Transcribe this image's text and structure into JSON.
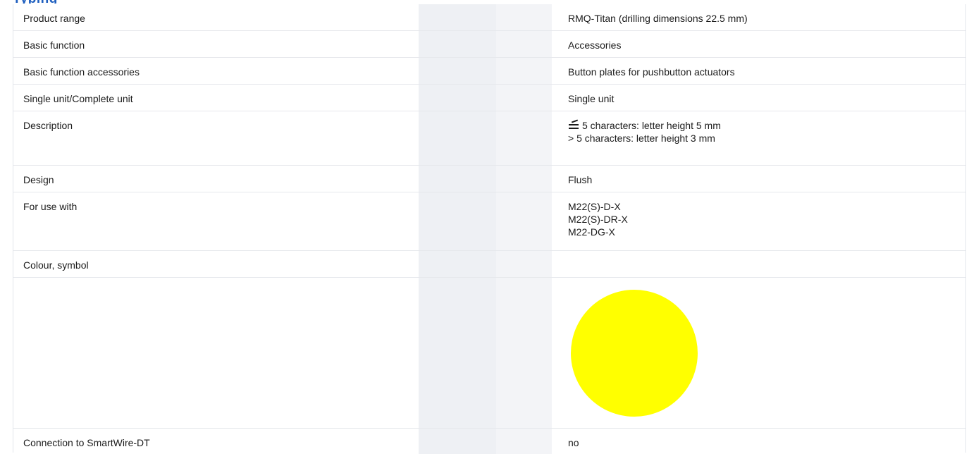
{
  "rows": [
    {
      "label": "Product range",
      "value": [
        "RMQ-Titan (drilling dimensions 22.5 mm)"
      ]
    },
    {
      "label": "Basic function",
      "value": [
        "Accessories"
      ]
    },
    {
      "label": "Basic function accessories",
      "value": [
        "Button plates for pushbutton actuators"
      ]
    },
    {
      "label": "Single unit/Complete unit",
      "value": [
        "Single unit"
      ]
    },
    {
      "label": "Description",
      "value": [
        "5 characters: letter height 5 mm",
        "> 5 characters: letter height 3 mm"
      ],
      "icon": "less-equal-icon"
    },
    {
      "label": "Design",
      "value": [
        "Flush"
      ]
    },
    {
      "label": "For use with",
      "value": [
        "M22(S)-D-X",
        "M22(S)-DR-X",
        "M22-DG-X"
      ]
    },
    {
      "label": "Colour, symbol",
      "value": [
        ""
      ]
    },
    {
      "label": "",
      "value": [
        ""
      ],
      "swatch_color": "#FFFF00"
    },
    {
      "label": "Connection to SmartWire-DT",
      "value": [
        "no"
      ]
    }
  ]
}
